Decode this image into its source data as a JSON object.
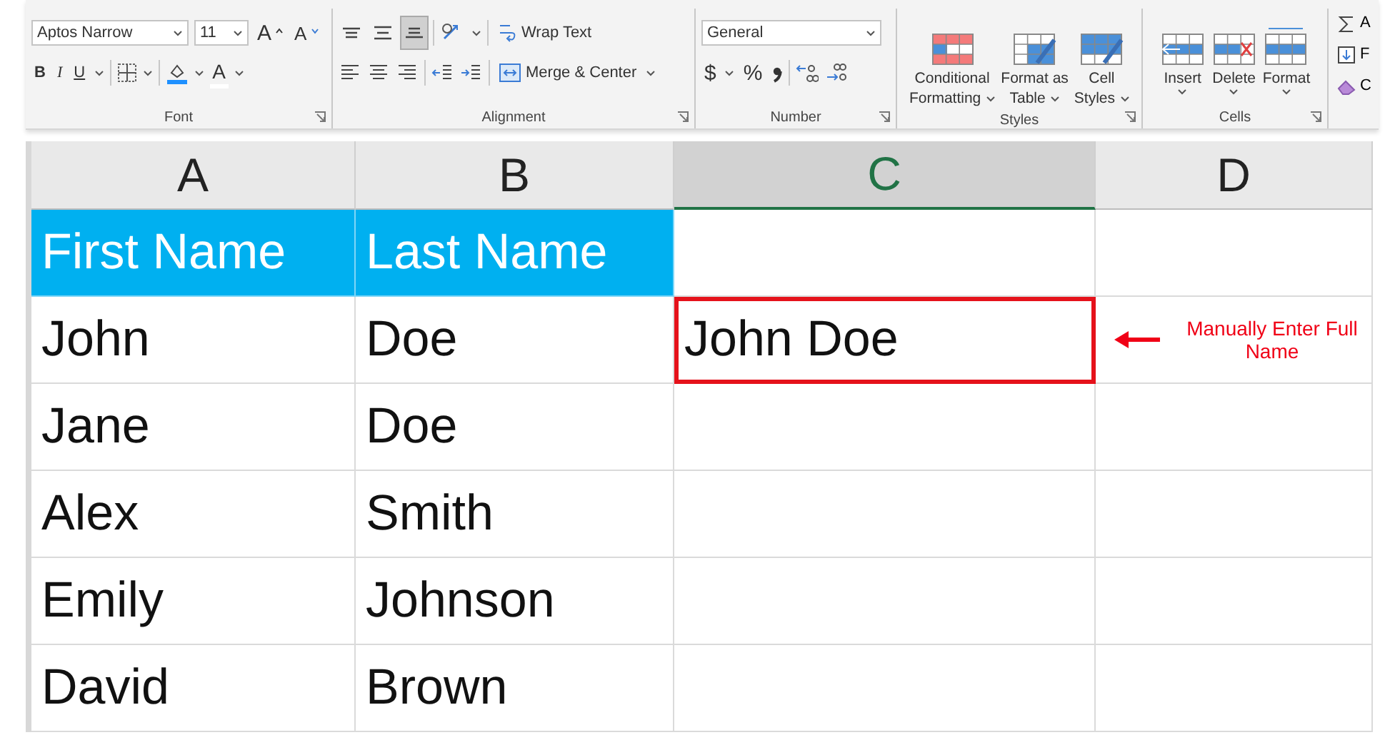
{
  "ribbon": {
    "font": {
      "label": "Font",
      "font_name": "Aptos Narrow",
      "font_size": "11",
      "grow": "A",
      "shrink": "A",
      "bold": "B",
      "italic": "I",
      "underline": "U",
      "font_color": "A"
    },
    "alignment": {
      "label": "Alignment",
      "vertical": [
        {
          "selected": false
        },
        {
          "selected": false
        },
        {
          "selected": true
        }
      ],
      "wrap_text": "Wrap Text",
      "merge_center": "Merge & Center"
    },
    "number": {
      "label": "Number",
      "format": "General",
      "currency": "$",
      "percent": "%"
    },
    "styles": {
      "label": "Styles",
      "buttons": [
        {
          "lines": [
            "Conditional",
            "Formatting"
          ],
          "kind": "conditional"
        },
        {
          "lines": [
            "Format as",
            "Table"
          ],
          "kind": "table"
        },
        {
          "lines": [
            "Cell",
            "Styles"
          ],
          "kind": "cellstyle"
        }
      ]
    },
    "cells": {
      "label": "Cells",
      "buttons": [
        {
          "label": "Insert",
          "kind": "insert"
        },
        {
          "label": "Delete",
          "kind": "delete"
        },
        {
          "label": "Format",
          "kind": "format"
        }
      ]
    },
    "editing": {
      "items": [
        {
          "label": "A",
          "kind": "sum"
        },
        {
          "label": "F",
          "kind": "fill"
        },
        {
          "label": "C",
          "kind": "clear"
        }
      ]
    }
  },
  "sheet": {
    "columns": [
      {
        "letter": "A",
        "selected": false
      },
      {
        "letter": "B",
        "selected": false
      },
      {
        "letter": "C",
        "selected": true
      },
      {
        "letter": "D",
        "selected": false
      }
    ],
    "rows": [
      {
        "kind": "header",
        "cells": [
          {
            "text": "First Name",
            "outlined": false
          },
          {
            "text": "Last Name",
            "outlined": false
          }
        ]
      },
      {
        "kind": "data",
        "cells": [
          {
            "text": "John",
            "outlined": false
          },
          {
            "text": "Doe",
            "outlined": false
          },
          {
            "text": "John Doe",
            "outlined": true
          }
        ],
        "note": "Manually Enter Full Name"
      },
      {
        "kind": "data",
        "cells": [
          {
            "text": "Jane",
            "outlined": false
          },
          {
            "text": "Doe",
            "outlined": false
          }
        ]
      },
      {
        "kind": "data",
        "cells": [
          {
            "text": "Alex",
            "outlined": false
          },
          {
            "text": "Smith",
            "outlined": false
          }
        ]
      },
      {
        "kind": "data",
        "cells": [
          {
            "text": "Emily",
            "outlined": false
          },
          {
            "text": "Johnson",
            "outlined": false
          }
        ]
      },
      {
        "kind": "data",
        "cells": [
          {
            "text": "David",
            "outlined": false
          },
          {
            "text": "Brown",
            "outlined": false
          }
        ]
      }
    ]
  }
}
